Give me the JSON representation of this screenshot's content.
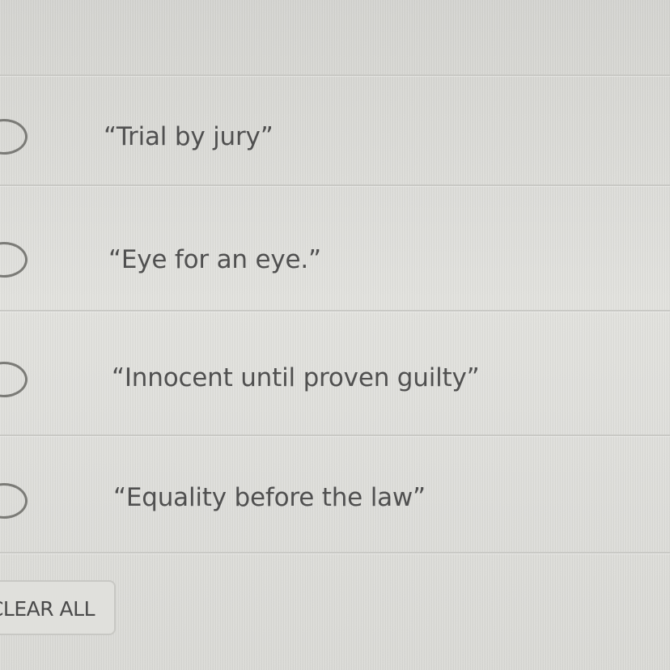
{
  "question": {
    "options": [
      {
        "label": "“Trial by jury”"
      },
      {
        "label": "“Eye for an eye.”"
      },
      {
        "label": "“Innocent until proven guilty”"
      },
      {
        "label": "“Equality before the law”"
      }
    ],
    "clear_all_label": "CLEAR ALL"
  },
  "colors": {
    "text": "#505050",
    "radio_border": "#7b7b77",
    "divider": "#c9c9c5"
  }
}
